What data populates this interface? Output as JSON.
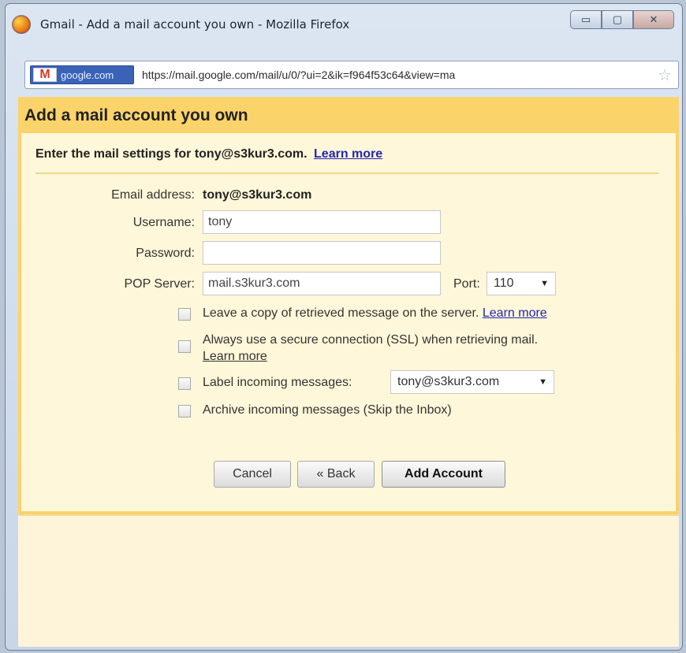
{
  "window": {
    "title": "Gmail - Add a mail account you own - Mozilla Firefox",
    "buttons": {
      "minimize": "▭",
      "maximize": "▢",
      "close": "✕"
    }
  },
  "urlbar": {
    "site_badge": "google.com",
    "url": "https://mail.google.com/mail/u/0/?ui=2&ik=f964f53c64&view=ma",
    "icons": {
      "site": "gmail-icon",
      "bookmark": "star-icon"
    }
  },
  "dialog": {
    "title": "Add a mail account you own",
    "intro": "Enter the mail settings for tony@s3kur3.com.",
    "intro_link": "Learn more",
    "fields": {
      "email_label": "Email address:",
      "email_value": "tony@s3kur3.com",
      "username_label": "Username:",
      "username_value": "tony",
      "password_label": "Password:",
      "password_value": "",
      "pop_label": "POP Server:",
      "pop_value": "mail.s3kur3.com",
      "port_label": "Port:",
      "port_value": "110"
    },
    "options": {
      "leave_copy": "Leave a copy of retrieved message on the server.",
      "leave_copy_link": "Learn more",
      "ssl": "Always use a secure connection (SSL) when retrieving mail.",
      "ssl_link": "Learn more",
      "label_incoming": "Label incoming messages:",
      "label_value": "tony@s3kur3.com",
      "archive": "Archive incoming messages (Skip the Inbox)"
    },
    "buttons": {
      "cancel": "Cancel",
      "back": "« Back",
      "add": "Add Account"
    }
  }
}
